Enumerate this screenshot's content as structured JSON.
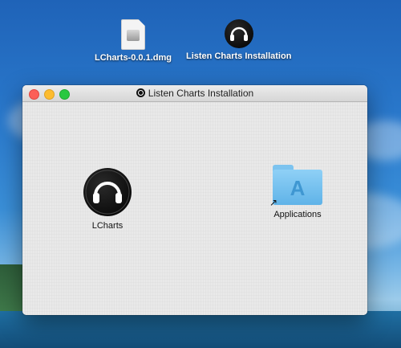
{
  "desktop": {
    "icons": [
      {
        "label": "LCharts-0.0.1.dmg",
        "icon": "dmg-file-icon"
      },
      {
        "label": "Listen Charts Installation",
        "icon": "headphones-disk-icon"
      }
    ]
  },
  "window": {
    "title": "Listen Charts Installation",
    "items": [
      {
        "label": "LCharts",
        "icon": "headphones-app-icon"
      },
      {
        "label": "Applications",
        "icon": "applications-folder-icon"
      }
    ]
  },
  "colors": {
    "close": "#fc5f57",
    "minimize": "#fdbc2e",
    "maximize": "#28c840",
    "folder": "#5fb3e8"
  }
}
